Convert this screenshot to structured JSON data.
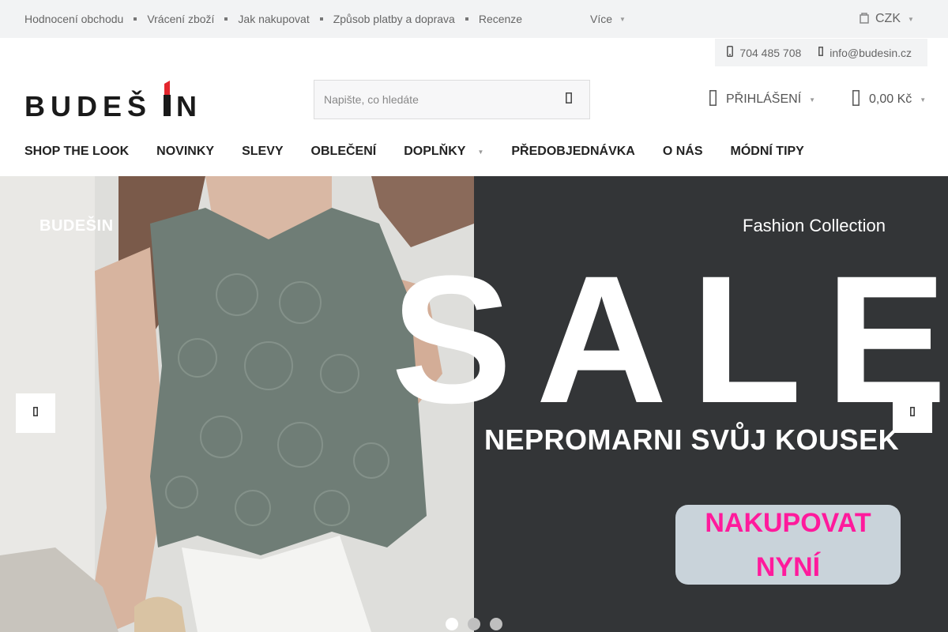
{
  "topbar": {
    "links": [
      "Hodnocení obchodu",
      "Vrácení zboží",
      "Jak nakupovat",
      "Způsob platby a doprava",
      "Recenze"
    ],
    "more": "Více",
    "currency": "CZK"
  },
  "contact": {
    "phone": "704 485 708",
    "email": "info@budesin.cz"
  },
  "logo": {
    "text_left": "BUDEŠ",
    "text_right": "IN",
    "colors": {
      "text": "#1a1a1a",
      "lipstick": "#e3262d"
    }
  },
  "search": {
    "placeholder": "Napište, co hledáte",
    "value": ""
  },
  "account": {
    "login": "PŘIHLÁŠENÍ",
    "cart_total": "0,00 Kč"
  },
  "nav": {
    "items": [
      "SHOP THE LOOK",
      "NOVINKY",
      "SLEVY",
      "OBLEČENÍ",
      "DOPLŇKY",
      "PŘEDOBJEDNÁVKA",
      "O NÁS",
      "MÓDNÍ TIPY"
    ]
  },
  "hero": {
    "brand": "BUDEŠIN",
    "collection": "Fashion Collection",
    "sale": "SALE",
    "tagline": "NEPROMARNI SVŮJ KOUSEK",
    "cta_line1": "NAKUPOVAT",
    "cta_line2": "NYNÍ",
    "colors": {
      "dark_panel": "#333537",
      "cta_text": "#ff1a9c",
      "cta_bg": "#c9d3da",
      "top": "#6f7d76"
    },
    "slides_total": 3,
    "active_slide": 1
  }
}
